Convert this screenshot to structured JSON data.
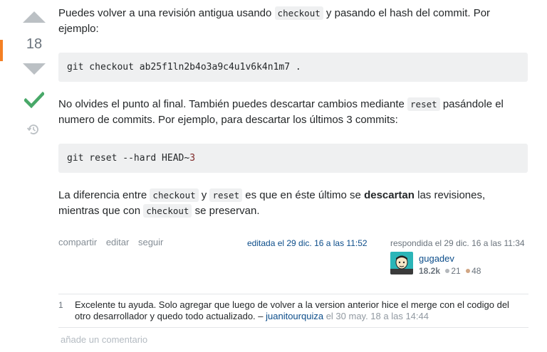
{
  "vote": {
    "score": "18"
  },
  "answer": {
    "p1": {
      "before": "Puedes volver a una revisión antigua usando ",
      "code": "checkout",
      "after1": " y pasando el hash del commit. Por",
      "after2": "ejemplo:"
    },
    "code1": "git checkout ab25f1ln2b4o3a9c4u1v6k4n1m7 .",
    "p2": {
      "before": "No olvides el punto al final. También puedes descartar cambios mediante ",
      "code": "reset",
      "after1": " pasándole el",
      "after2": "numero de commits. Por ejemplo, para descartar los últimos 3 commits:"
    },
    "code2": {
      "text": "git reset --hard HEAD~",
      "num": "3"
    },
    "p3": {
      "t1": "La diferencia entre ",
      "code1": "checkout",
      "t2": " y ",
      "code2": "reset",
      "t3": " es que en éste último se ",
      "bold": "descartan",
      "t4": " las revisiones,",
      "t5": "mientras que con ",
      "code3": "checkout",
      "t6": " se preservan."
    }
  },
  "menu": {
    "share": "compartir",
    "edit": "editar",
    "follow": "seguir"
  },
  "edited": "editada el 29 dic. 16 a las 11:52",
  "answered": "respondida el 29 dic. 16 a las 11:34",
  "author": {
    "name": "gugadev",
    "rep": "18.2k",
    "silver": "21",
    "bronze": "48"
  },
  "comments": [
    {
      "score": "1",
      "text_line1": "Excelente tu ayuda. Solo agregar que luego de volver a la version anterior hice el merge con el codigo del",
      "text_line2": "otro desarrollador y quedo todo actualizado. – ",
      "user": "juanitourquiza",
      "date": " el 30 may. 18 a las 14:44"
    }
  ],
  "add_comment": "añade un comentario",
  "colors": {
    "accent": "#f48024",
    "accepted": "#48a868",
    "link": "#0c4d8a",
    "silver": "#b4b8bc",
    "bronze": "#d1a684"
  }
}
